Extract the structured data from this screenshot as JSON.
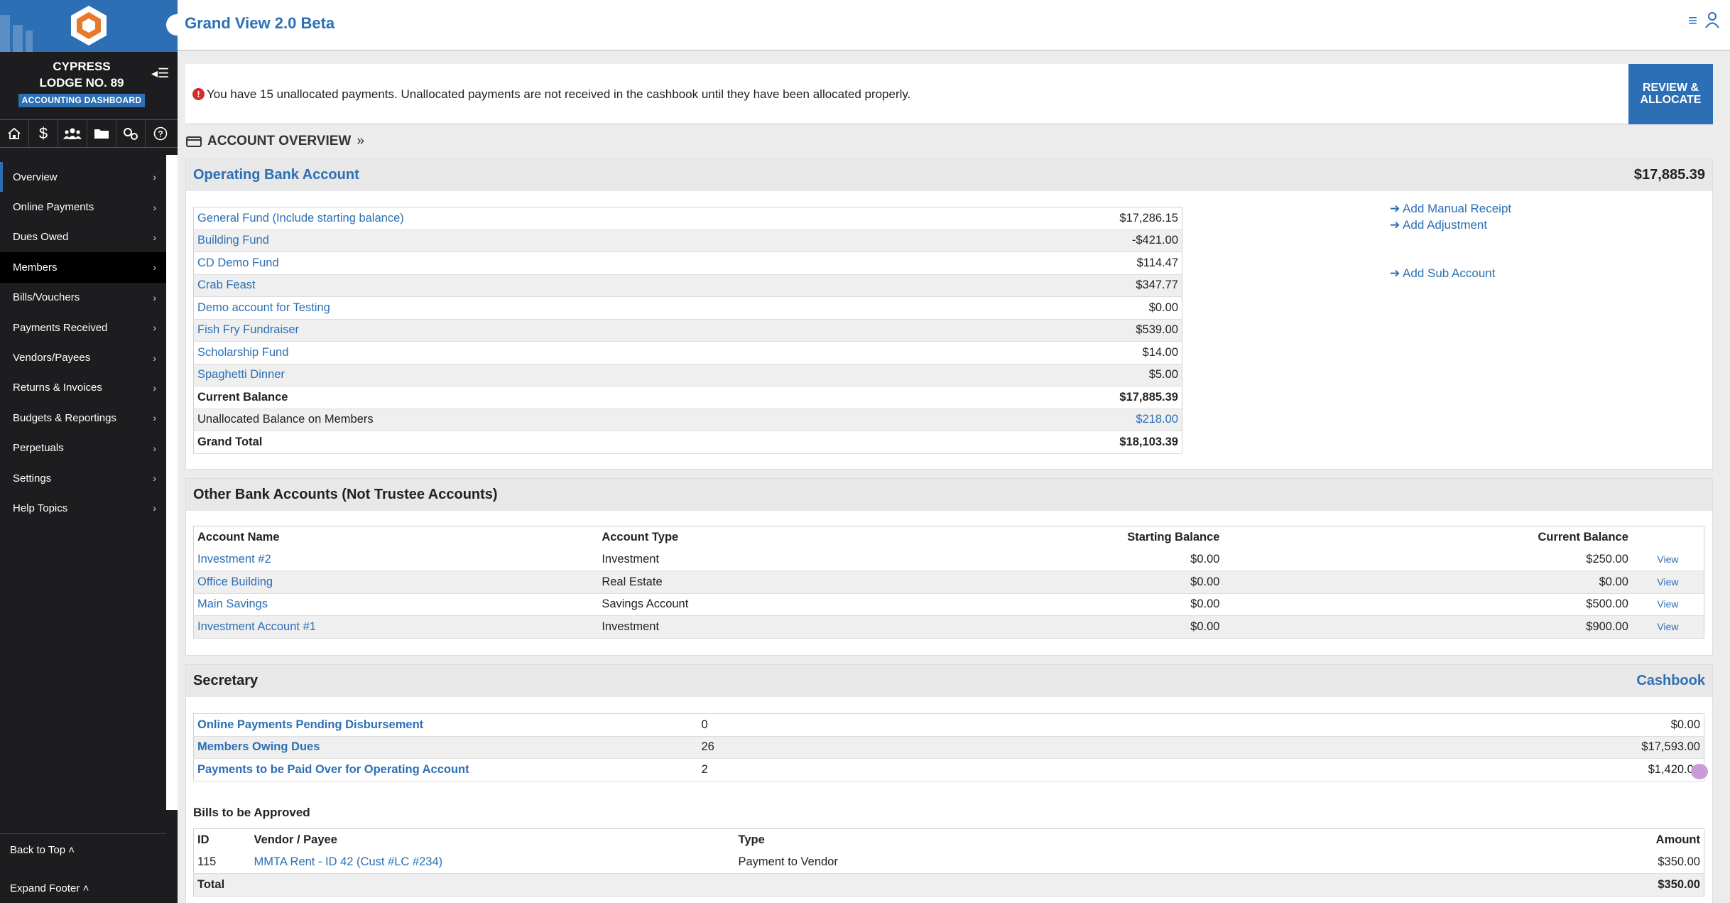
{
  "app": {
    "title": "Grand View 2.0 Beta"
  },
  "sidebar": {
    "lodge_line1": "CYPRESS",
    "lodge_line2": "LODGE NO. 89",
    "badge": "ACCOUNTING DASHBOARD",
    "toolbar_icons": [
      "home-icon",
      "dollar-icon",
      "members-icon",
      "folder-icon",
      "settings-icon",
      "help-icon"
    ],
    "items": [
      {
        "label": "Overview"
      },
      {
        "label": "Online Payments"
      },
      {
        "label": "Dues Owed"
      },
      {
        "label": "Members"
      },
      {
        "label": "Bills/Vouchers"
      },
      {
        "label": "Payments Received"
      },
      {
        "label": "Vendors/Payees"
      },
      {
        "label": "Returns & Invoices"
      },
      {
        "label": "Budgets & Reportings"
      },
      {
        "label": "Perpetuals"
      },
      {
        "label": "Settings"
      },
      {
        "label": "Help Topics"
      }
    ],
    "back_to_top": "Back to Top",
    "expand_footer": "Expand Footer"
  },
  "alert": {
    "text": "You have 15 unallocated payments. Unallocated payments are not received in the cashbook until they have been allocated properly.",
    "button_line1": "REVIEW &",
    "button_line2": "ALLOCATE"
  },
  "overview": {
    "heading": "ACCOUNT OVERVIEW"
  },
  "operating": {
    "title": "Operating Bank Account",
    "total": "$17,885.39",
    "rows": [
      {
        "name": "General Fund (Include starting balance)",
        "amount": "$17,286.15"
      },
      {
        "name": "Building Fund",
        "amount": "-$421.00"
      },
      {
        "name": "CD Demo Fund",
        "amount": "$114.47"
      },
      {
        "name": "Crab Feast",
        "amount": "$347.77"
      },
      {
        "name": "Demo account for Testing",
        "amount": "$0.00"
      },
      {
        "name": "Fish Fry Fundraiser",
        "amount": "$539.00"
      },
      {
        "name": "Scholarship Fund",
        "amount": "$14.00"
      },
      {
        "name": "Spaghetti Dinner",
        "amount": "$5.00"
      }
    ],
    "current_balance_label": "Current Balance",
    "current_balance": "$17,885.39",
    "unallocated_label": "Unallocated Balance on Members",
    "unallocated": "$218.00",
    "grand_total_label": "Grand Total",
    "grand_total": "$18,103.39",
    "actions": {
      "manual_receipt": "Add Manual Receipt",
      "adjustment": "Add Adjustment",
      "sub_account": "Add Sub Account"
    }
  },
  "other_accounts": {
    "title": "Other Bank Accounts (Not Trustee Accounts)",
    "columns": [
      "Account Name",
      "Account Type",
      "Starting Balance",
      "Current Balance"
    ],
    "view_label": "View",
    "rows": [
      {
        "name": "Investment #2",
        "type": "Investment",
        "start": "$0.00",
        "current": "$250.00"
      },
      {
        "name": "Office Building",
        "type": "Real Estate",
        "start": "$0.00",
        "current": "$0.00"
      },
      {
        "name": "Main Savings",
        "type": "Savings Account",
        "start": "$0.00",
        "current": "$500.00"
      },
      {
        "name": "Investment Account #1",
        "type": "Investment",
        "start": "$0.00",
        "current": "$900.00"
      }
    ]
  },
  "secretary": {
    "title": "Secretary",
    "cashbook": "Cashbook",
    "rows": [
      {
        "label": "Online Payments Pending Disbursement",
        "count": "0",
        "amount": "$0.00"
      },
      {
        "label": "Members Owing Dues",
        "count": "26",
        "amount": "$17,593.00"
      },
      {
        "label": "Payments to be Paid Over for Operating Account",
        "count": "2",
        "amount": "$1,420.00"
      }
    ],
    "bills_title": "Bills to be Approved",
    "bills_columns": [
      "ID",
      "Vendor / Payee",
      "Type",
      "Amount"
    ],
    "bills": [
      {
        "id": "115",
        "vendor": "MMTA Rent - ID 42 (Cust #LC #234)",
        "type": "Payment to Vendor",
        "amount": "$350.00"
      }
    ],
    "bills_total_label": "Total",
    "bills_total": "$350.00"
  }
}
